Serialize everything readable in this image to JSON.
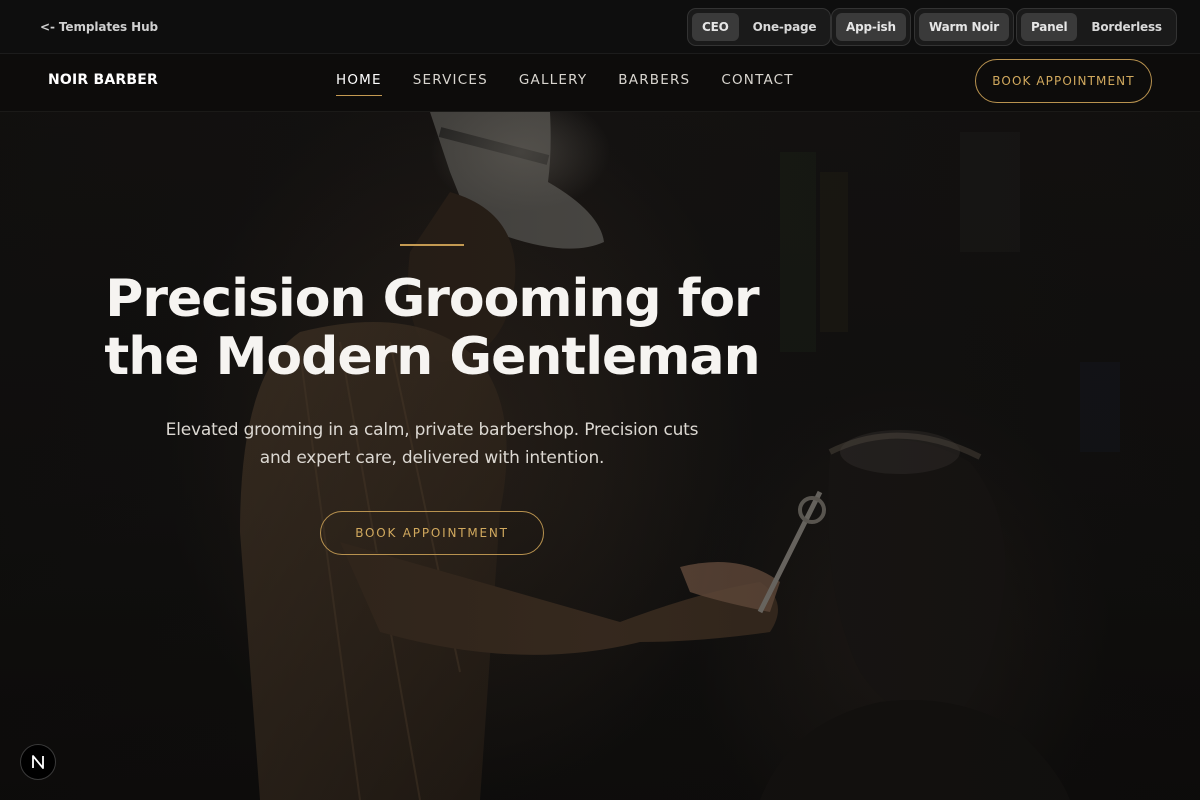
{
  "utility": {
    "hub_link": "<- Templates Hub",
    "groups": [
      {
        "options": [
          "CEO",
          "One-page"
        ],
        "active": "CEO"
      },
      {
        "options": [
          "App-ish"
        ],
        "active": "App-ish"
      },
      {
        "options": [
          "Warm Noir"
        ],
        "active": "Warm Noir"
      },
      {
        "options": [
          "Panel",
          "Borderless"
        ],
        "active": "Panel"
      }
    ]
  },
  "nav": {
    "brand": "NOIR BARBER",
    "links": [
      "HOME",
      "SERVICES",
      "GALLERY",
      "BARBERS",
      "CONTACT"
    ],
    "active_link": "HOME",
    "cta": "BOOK APPOINTMENT"
  },
  "hero": {
    "title": "Precision Grooming for the Modern Gentleman",
    "subtitle": "Elevated grooming in a calm, private barbershop. Precision cuts and expert care, delivered with intention.",
    "cta": "BOOK APPOINTMENT"
  },
  "badge": {
    "icon": "n-logo-icon"
  },
  "colors": {
    "accent_gold": "#c49a52",
    "background": "#121110",
    "text": "#f6f4f1"
  }
}
